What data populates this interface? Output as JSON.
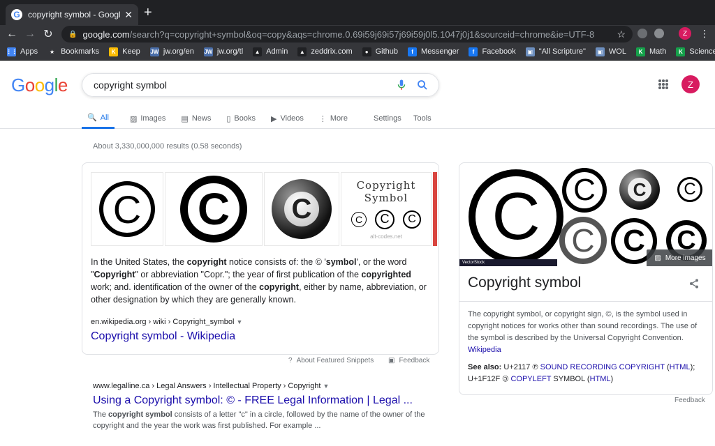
{
  "browser": {
    "tab_title": "copyright symbol - Google Search",
    "favicon_letter": "G",
    "url_host": "google.com",
    "url_rest": "/search?q=copyright+symbol&oq=copy&aqs=chrome.0.69i59j69i57j69i59j0l5.1047j0j1&sourceid=chrome&ie=UTF-8",
    "profile_letter": "Z"
  },
  "bookmarks": [
    {
      "label": "Apps",
      "color": "#4285f4",
      "glyph": "⋮⋮"
    },
    {
      "label": "Bookmarks",
      "color": "#35363a",
      "glyph": "★"
    },
    {
      "label": "Keep",
      "color": "#fbbc04",
      "glyph": "K"
    },
    {
      "label": "jw.org/en",
      "color": "#4a6ea9",
      "glyph": "JW"
    },
    {
      "label": "jw.org/tl",
      "color": "#4a6ea9",
      "glyph": "JW"
    },
    {
      "label": "Admin",
      "color": "#202124",
      "glyph": "▲"
    },
    {
      "label": "zeddrix.com",
      "color": "#202124",
      "glyph": "▲"
    },
    {
      "label": "Github",
      "color": "#202124",
      "glyph": "●"
    },
    {
      "label": "Messenger",
      "color": "#1877f2",
      "glyph": "f"
    },
    {
      "label": "Facebook",
      "color": "#1877f2",
      "glyph": "f"
    },
    {
      "label": "\"All Scripture\"",
      "color": "#6d8fbf",
      "glyph": "▣"
    },
    {
      "label": "WOL",
      "color": "#6d8fbf",
      "glyph": "▣"
    },
    {
      "label": "Math",
      "color": "#15a04a",
      "glyph": "K"
    },
    {
      "label": "Science",
      "color": "#15a04a",
      "glyph": "K"
    }
  ],
  "search": {
    "query": "copyright symbol",
    "tabs": [
      {
        "label": "All",
        "icon": "🔍"
      },
      {
        "label": "Images",
        "icon": "▨"
      },
      {
        "label": "News",
        "icon": "▤"
      },
      {
        "label": "Books",
        "icon": "▯"
      },
      {
        "label": "Videos",
        "icon": "▶"
      },
      {
        "label": "More",
        "icon": "⋮"
      }
    ],
    "settings_label": "Settings",
    "tools_label": "Tools",
    "stats": "About 3,330,000,000 results (0.58 seconds)",
    "avatar_letter": "Z"
  },
  "snippet": {
    "thumb_text_line1": "Copyright",
    "thumb_text_line2": "Symbol",
    "thumb_watermark": "alt-codes.net",
    "text_parts": [
      {
        "t": "In the United States, the ",
        "b": false
      },
      {
        "t": "copyright",
        "b": true
      },
      {
        "t": " notice consists of: the © '",
        "b": false
      },
      {
        "t": "symbol",
        "b": true
      },
      {
        "t": "', or the word \"",
        "b": false
      },
      {
        "t": "Copyright",
        "b": true
      },
      {
        "t": "\" or abbreviation \"Copr.\"; the year of first publication of the ",
        "b": false
      },
      {
        "t": "copyrighted",
        "b": true
      },
      {
        "t": " work; and. identification of the owner of the ",
        "b": false
      },
      {
        "t": "copyright",
        "b": true
      },
      {
        "t": ", either by name, abbreviation, or other designation by which they are generally known.",
        "b": false
      }
    ],
    "cite": "en.wikipedia.org › wiki › Copyright_symbol",
    "link": "Copyright symbol - Wikipedia",
    "about_label": "About Featured Snippets",
    "feedback_label": "Feedback"
  },
  "result2": {
    "cite": "www.legalline.ca › Legal Answers › Intellectual Property › Copyright",
    "title": "Using a Copyright symbol: © - FREE Legal Information | Legal ...",
    "snip_parts": [
      {
        "t": "The ",
        "b": false
      },
      {
        "t": "copyright symbol",
        "b": true
      },
      {
        "t": " consists of a letter \"c\" in a circle, followed by the name of the owner of the copyright and the year the work was first published. For example ...",
        "b": false
      }
    ]
  },
  "knowledge_panel": {
    "more_images_label": "More images",
    "vectorstock_label": "VectorStock",
    "title": "Copyright symbol",
    "description": "The copyright symbol, or copyright sign, ©, is the symbol used in copyright notices for works other than sound recordings. The use of the symbol is described by the Universal Copyright Convention.",
    "source_link": "Wikipedia",
    "see_also_label": "See also:",
    "see_also_1_code": "U+2117 ℗",
    "see_also_1_link": "SOUND RECORDING COPYRIGHT",
    "see_also_1_html": "HTML",
    "see_also_2_code": "U+1F12F 🄯",
    "see_also_2_link": "COPYLEFT",
    "see_also_2_rest": "SYMBOL",
    "see_also_2_html": "HTML",
    "feedback_label": "Feedback"
  }
}
